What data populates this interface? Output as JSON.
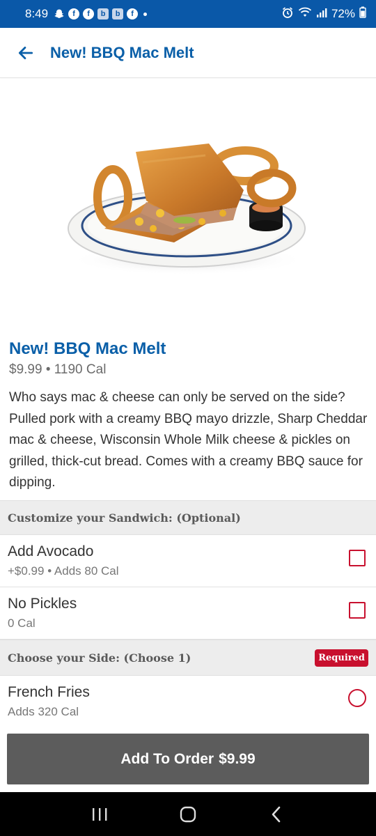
{
  "status_bar": {
    "time": "8:49",
    "battery": "72%",
    "left_icons": [
      "snapchat-icon",
      "facebook-icon",
      "facebook-icon",
      "b-app-icon",
      "b-app-icon",
      "facebook-icon"
    ],
    "b_letter": "b",
    "f_letter": "f"
  },
  "header": {
    "title": "New! BBQ Mac Melt"
  },
  "product": {
    "name": "New! BBQ Mac Melt",
    "price": "$9.99",
    "separator": " • ",
    "calories": "1190 Cal",
    "description": "Who says mac & cheese can only be served on the side? Pulled pork with a creamy BBQ mayo drizzle, Sharp Cheddar mac & cheese, Wisconsin Whole Milk cheese & pickles on grilled, thick-cut bread. Comes with a creamy BBQ sauce for dipping."
  },
  "customize_section": {
    "title": "Customize your Sandwich: (Optional)",
    "options": [
      {
        "name": "Add Avocado",
        "details": "+$0.99 • Adds 80 Cal",
        "checked": false
      },
      {
        "name": "No Pickles",
        "details": "0 Cal",
        "checked": false
      }
    ]
  },
  "side_section": {
    "title": "Choose your Side: (Choose 1)",
    "badge": "Required",
    "options": [
      {
        "name": "French Fries",
        "details": "Adds 320 Cal",
        "selected": false
      }
    ]
  },
  "order_button": {
    "label": "Add To Order",
    "price": "$9.99"
  },
  "colors": {
    "brand_blue": "#0a5fa8",
    "status_blue": "#0a58a8",
    "accent_red": "#c8102e",
    "button_gray": "#5c5c5c"
  }
}
